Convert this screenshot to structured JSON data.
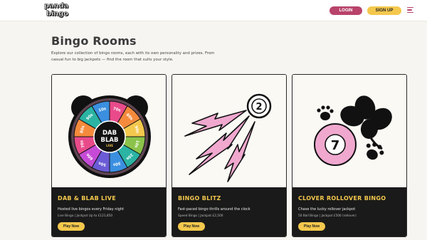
{
  "header": {
    "logo_line1": "panda",
    "logo_line2": "bingo",
    "login_label": "LOGIN",
    "signup_label": "SIGN UP"
  },
  "main": {
    "title": "Bingo Rooms",
    "intro": "Explore our collection of bingo rooms, each with its own personality and prizes. From casual fun to big jackpots — find the room that suits your style."
  },
  "rooms": [
    {
      "name": "DAB & BLAB LIVE",
      "description": "Hosted live bingos every Friday night",
      "meta": "Live Bingo | Jackpot Up to £121,850",
      "cta": "Play Now",
      "wheel_label_top": "DAB",
      "wheel_label_mid": "BLAB",
      "wheel_label_sub": "LIVE",
      "wheel_numbers": [
        "70s",
        "80s",
        "90s",
        "10s",
        "20s",
        "30s",
        "50s",
        "60s",
        "70s",
        "80s",
        "90s",
        "10s"
      ]
    },
    {
      "name": "BINGO BLITZ",
      "description": "Fast-paced bingo thrills around the clock",
      "meta": "Speed Bingo | Jackpot £2,500",
      "cta": "Play Now",
      "ball_number": "2"
    },
    {
      "name": "CLOVER ROLLOVER BINGO",
      "description": "Chase the lucky rollover jackpot",
      "meta": "50 Ball Bingo | Jackpot £500 (rollover)",
      "cta": "Play Now",
      "ball_number": "7"
    }
  ],
  "colors": {
    "accent_pink": "#b8436b",
    "accent_yellow": "#f4c84d",
    "card_dark": "#1a1a1a",
    "art_pink": "#f0a8cf"
  }
}
